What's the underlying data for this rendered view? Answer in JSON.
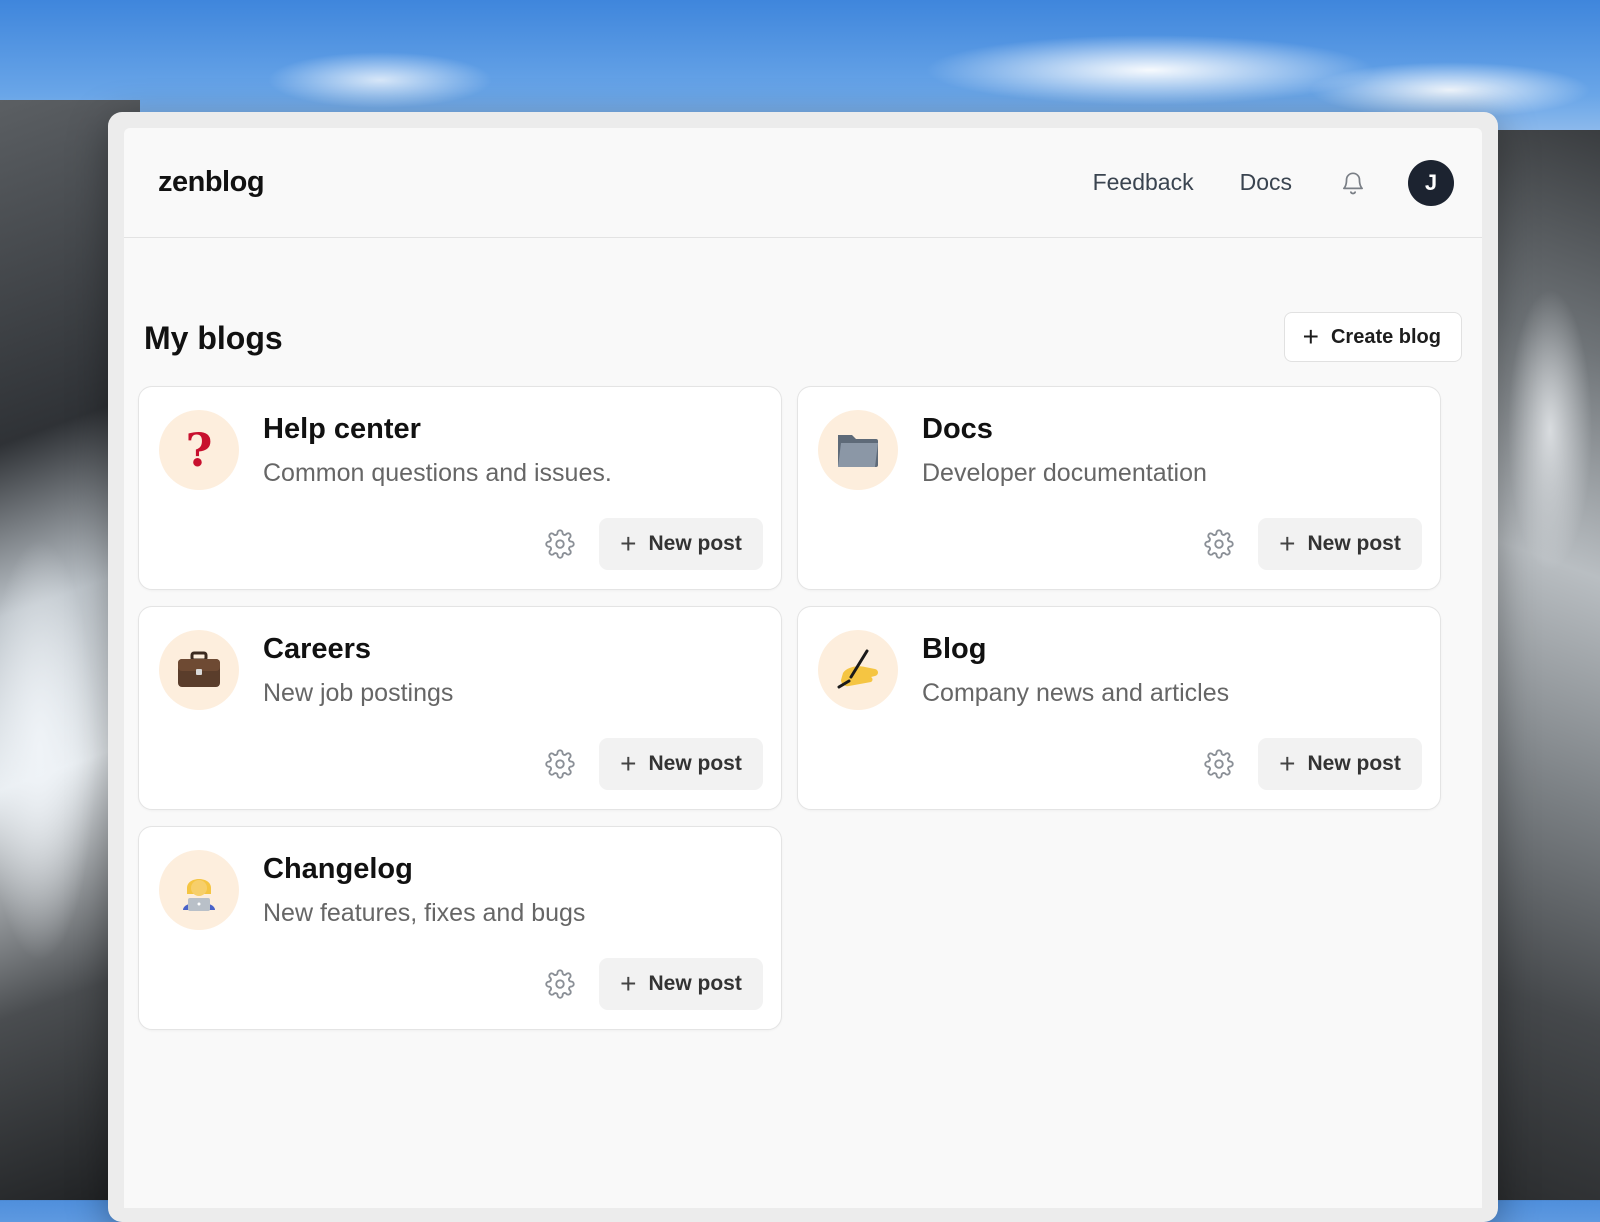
{
  "app": {
    "logo": "zenblog"
  },
  "nav": {
    "feedback": "Feedback",
    "docs": "Docs",
    "avatar_initial": "J"
  },
  "page": {
    "title": "My blogs",
    "create_button": "Create blog"
  },
  "blogs": [
    {
      "title": "Help center",
      "description": "Common questions and issues.",
      "icon": "question-mark-icon",
      "new_post": "New post"
    },
    {
      "title": "Docs",
      "description": "Developer documentation",
      "icon": "folder-icon",
      "new_post": "New post"
    },
    {
      "title": "Careers",
      "description": "New job postings",
      "icon": "briefcase-icon",
      "new_post": "New post"
    },
    {
      "title": "Blog",
      "description": "Company news and articles",
      "icon": "writing-hand-icon",
      "new_post": "New post"
    },
    {
      "title": "Changelog",
      "description": "New features, fixes and bugs",
      "icon": "technologist-icon",
      "new_post": "New post"
    }
  ]
}
